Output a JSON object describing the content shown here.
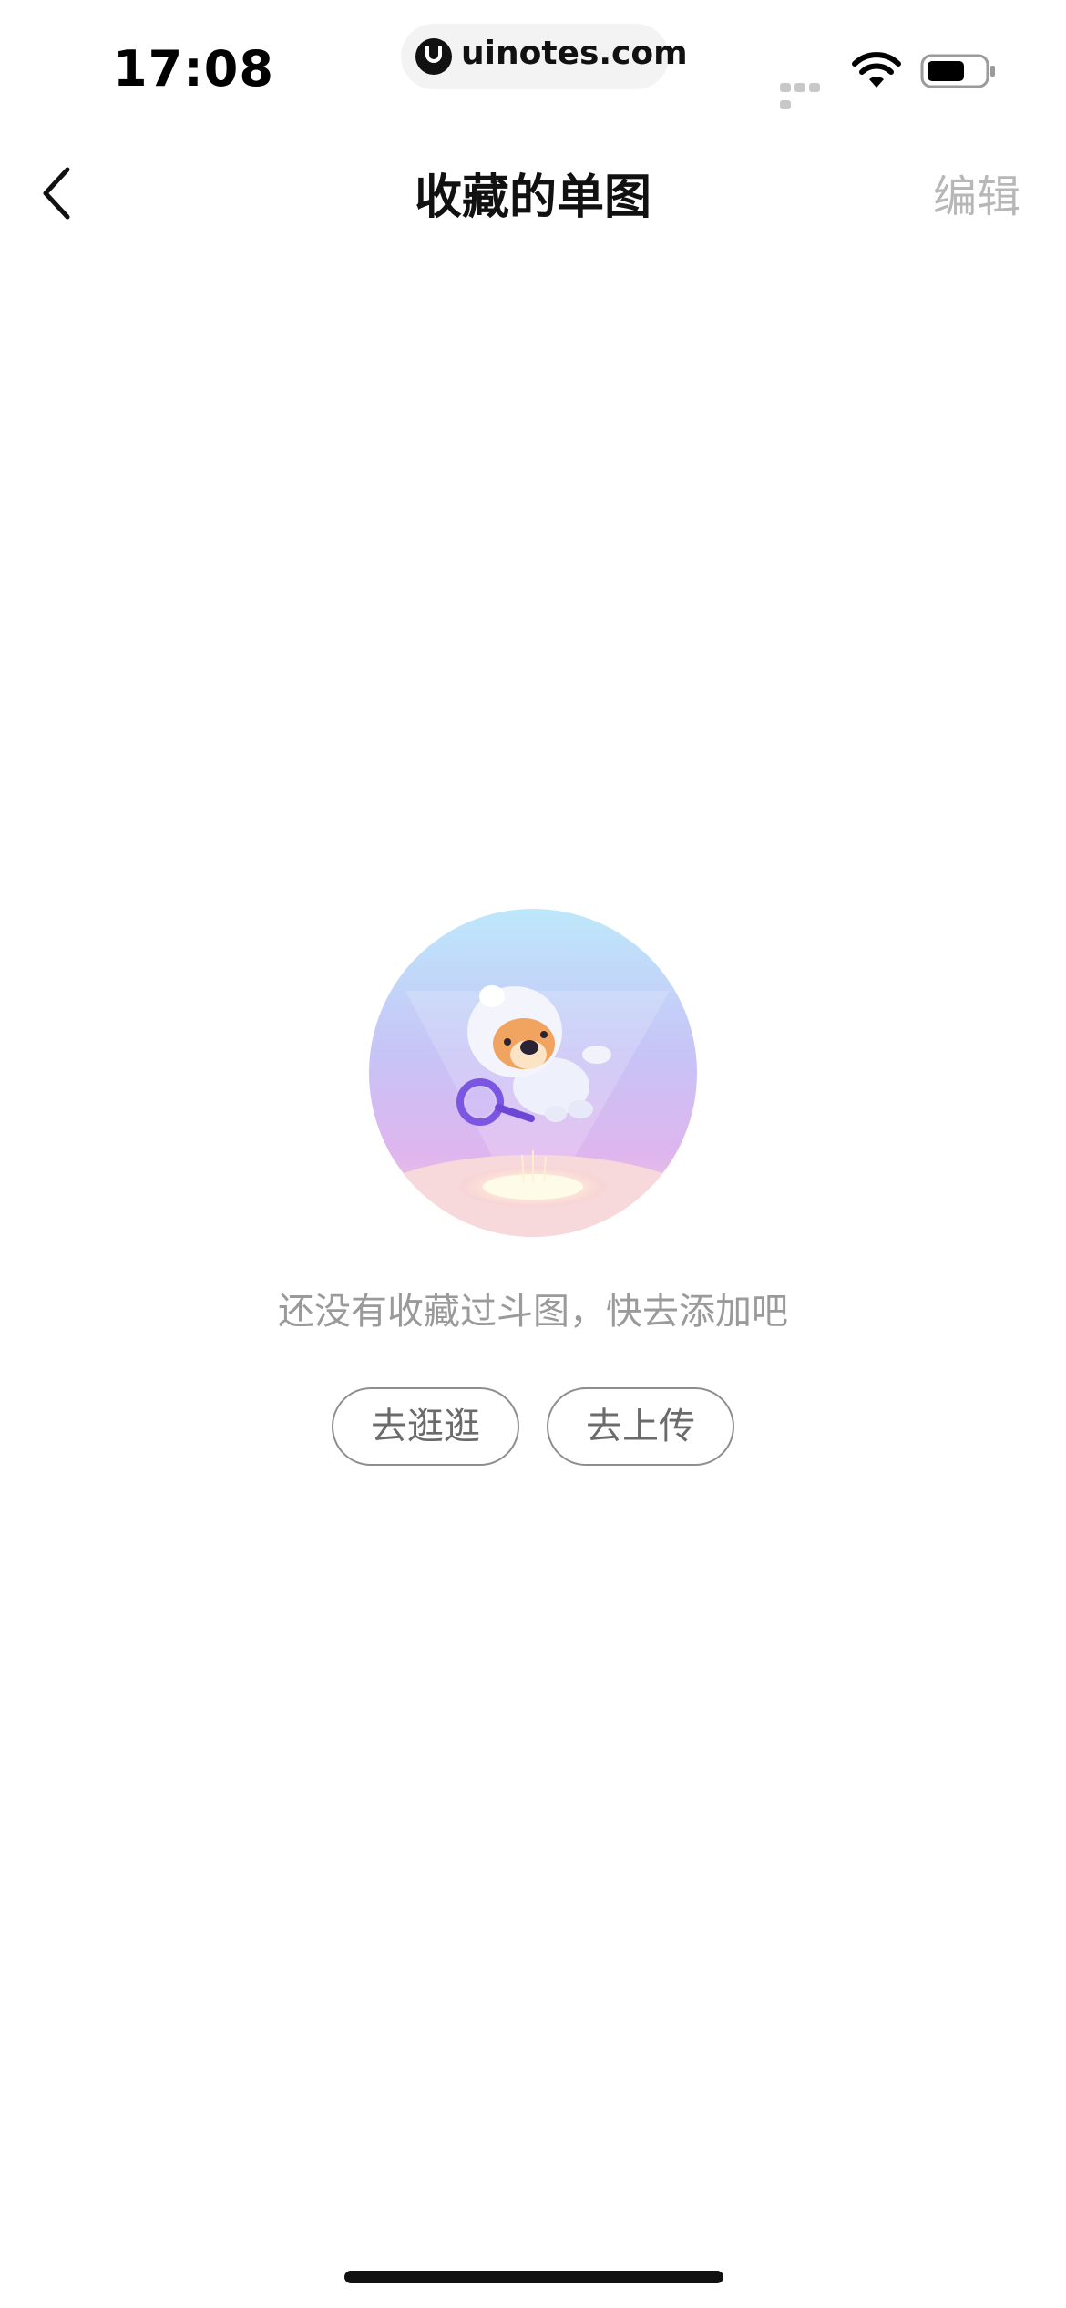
{
  "status_bar": {
    "time": "17:08",
    "url": "uinotes.com",
    "icons": [
      "cellular-signal-icon",
      "wifi-icon",
      "battery-icon"
    ]
  },
  "nav": {
    "back_icon": "chevron-left-icon",
    "title": "收藏的单图",
    "edit_label": "编辑"
  },
  "empty_state": {
    "illustration": "astronaut-dog-with-magnifier",
    "message": "还没有收藏过斗图，快去添加吧",
    "buttons": {
      "browse_label": "去逛逛",
      "upload_label": "去上传"
    }
  },
  "colors": {
    "text_primary": "#111111",
    "text_secondary": "#9a9a9a",
    "edit_disabled": "#b7b7b7",
    "button_border": "#8e8e8e"
  }
}
